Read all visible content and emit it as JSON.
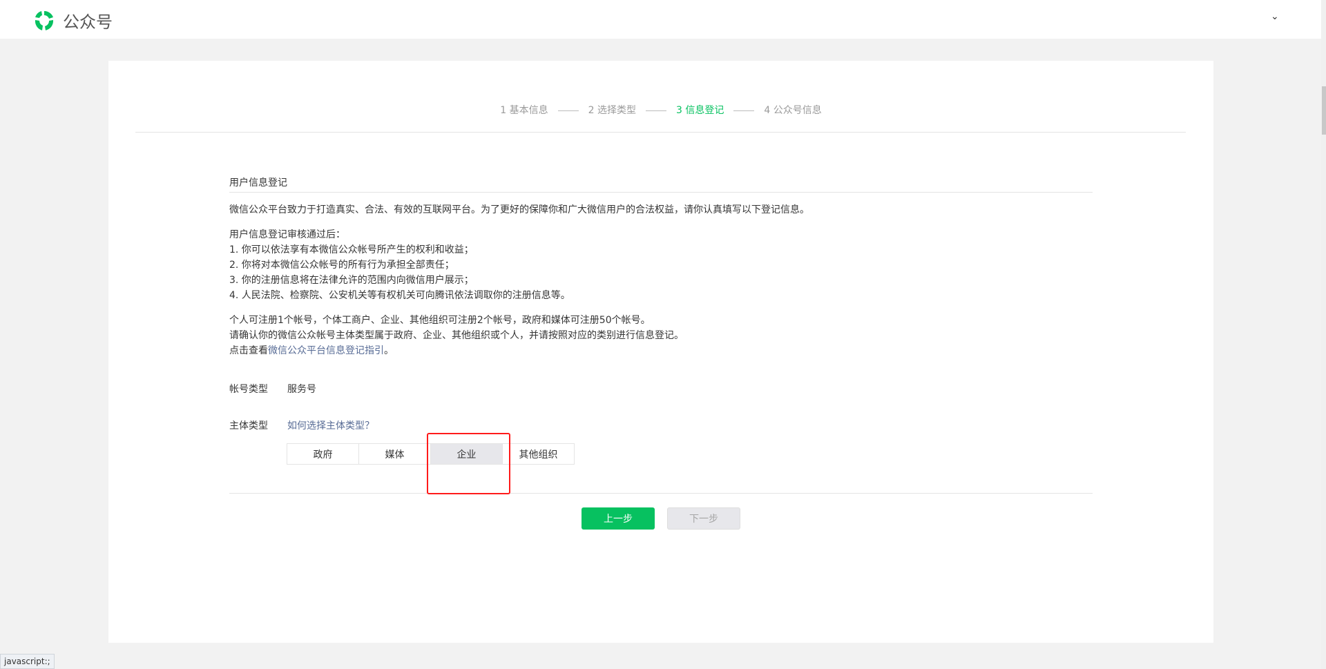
{
  "header": {
    "logo_text": "公众号",
    "brand_color": "#07c160"
  },
  "steps": [
    {
      "label": "1 基本信息"
    },
    {
      "label": "2 选择类型"
    },
    {
      "label": "3 信息登记",
      "active": true
    },
    {
      "label": "4 公众号信息"
    }
  ],
  "section": {
    "title": "用户信息登记",
    "intro": "微信公众平台致力于打造真实、合法、有效的互联网平台。为了更好的保障你和广大微信用户的合法权益，请你认真填写以下登记信息。",
    "after_title": "用户信息登记审核通过后：",
    "after_items": [
      "1. 你可以依法享有本微信公众帐号所产生的权利和收益；",
      "2. 你将对本微信公众帐号的所有行为承担全部责任；",
      "3. 你的注册信息将在法律允许的范围内向微信用户展示；",
      "4. 人民法院、检察院、公安机关等有权机关可向腾讯依法调取你的注册信息等。"
    ],
    "limits": "个人可注册1个帐号，个体工商户、企业、其他组织可注册2个帐号，政府和媒体可注册50个帐号。",
    "confirm": "请确认你的微信公众帐号主体类型属于政府、企业、其他组织或个人，并请按照对应的类别进行信息登记。",
    "guide_prefix": "点击查看",
    "guide_link": "微信公众平台信息登记指引",
    "guide_suffix": "。",
    "account_type_label": "帐号类型",
    "account_type_value": "服务号",
    "subject_type_label": "主体类型",
    "subject_help_link": "如何选择主体类型？",
    "subject_types": [
      {
        "label": "政府"
      },
      {
        "label": "媒体"
      },
      {
        "label": "企业",
        "selected": true
      },
      {
        "label": "其他组织"
      }
    ]
  },
  "buttons": {
    "prev": "上一步",
    "next": "下一步"
  },
  "status_bar": "javascript:;"
}
